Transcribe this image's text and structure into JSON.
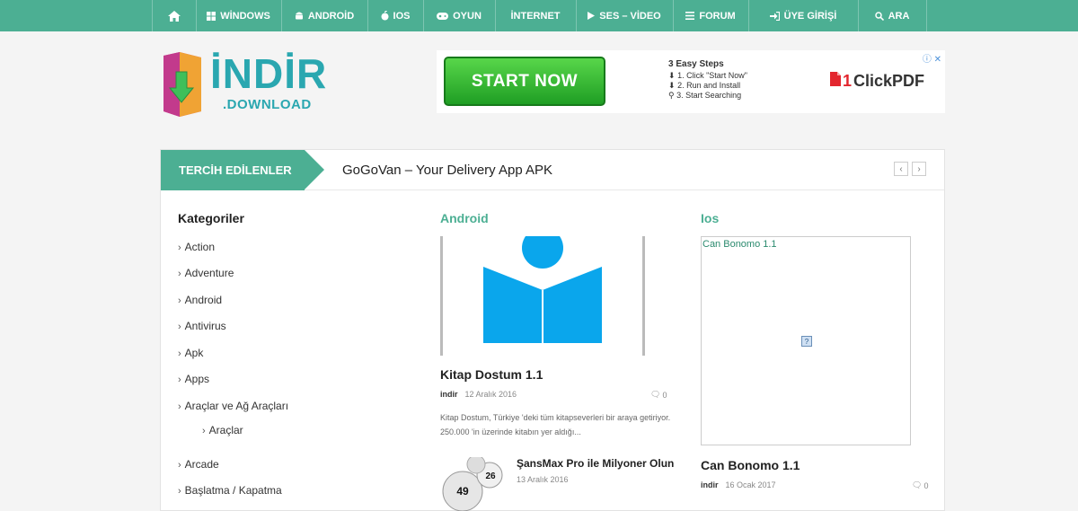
{
  "nav": {
    "items": [
      {
        "label": "",
        "icon": "home-icon"
      },
      {
        "label": "WİNDOWS",
        "icon": "windows-icon"
      },
      {
        "label": "ANDROİD",
        "icon": "android-icon"
      },
      {
        "label": "IOS",
        "icon": "apple-icon"
      },
      {
        "label": "OYUN",
        "icon": "gamepad-icon"
      },
      {
        "label": "İNTERNET",
        "icon": ""
      },
      {
        "label": "SES – VİDEO",
        "icon": "play-icon"
      },
      {
        "label": "FORUM",
        "icon": "menu-icon"
      },
      {
        "label": "ÜYE GİRİŞİ",
        "icon": "login-icon"
      },
      {
        "label": "ARA",
        "icon": "search-icon"
      }
    ]
  },
  "logo": {
    "title": "İNDİR",
    "subtitle": ".DOWNLOAD"
  },
  "ad": {
    "button": "START NOW",
    "steps_title": "3 Easy Steps",
    "steps": [
      "1. Click \"Start Now\"",
      "2. Run and Install",
      "3. Start Searching"
    ],
    "brand_number": "1",
    "brand_text": "ClickPDF",
    "brand_color": "#e3262e"
  },
  "ticker": {
    "label": "TERCİH EDİLENLER",
    "text": "GoGoVan – Your Delivery App APK",
    "prev": "‹",
    "next": "›"
  },
  "categories": {
    "title": "Kategoriler",
    "items": [
      "Action",
      "Adventure",
      "Android",
      "Antivirus",
      "Apk",
      "Apps",
      "Araçlar ve Ağ Araçları",
      "Araçlar",
      "Arcade",
      "Başlatma / Kapatma"
    ]
  },
  "android": {
    "title": "Android",
    "post_title": "Kitap Dostum 1.1",
    "author": "indir",
    "date": "12 Aralık 2016",
    "comments": "0",
    "excerpt": "Kitap Dostum, Türkiye 'deki tüm kitapseverleri bir araya getiriyor. 250.000 'in üzerinde kitabın yer aldığı...",
    "small_title": "ŞansMax Pro ile Milyoner Olun",
    "small_date": "13 Aralık 2016",
    "ball_numbers": [
      "49",
      "26"
    ]
  },
  "ios": {
    "title": "Ios",
    "box_label": "Can Bonomo 1.1",
    "box_icon": "?",
    "post_title": "Can Bonomo 1.1",
    "author": "indir",
    "date": "16 Ocak 2017",
    "comments": "0"
  },
  "colors": {
    "accent": "#4caf93",
    "link": "#2aa7b0",
    "book_blue": "#0aa6ec"
  }
}
